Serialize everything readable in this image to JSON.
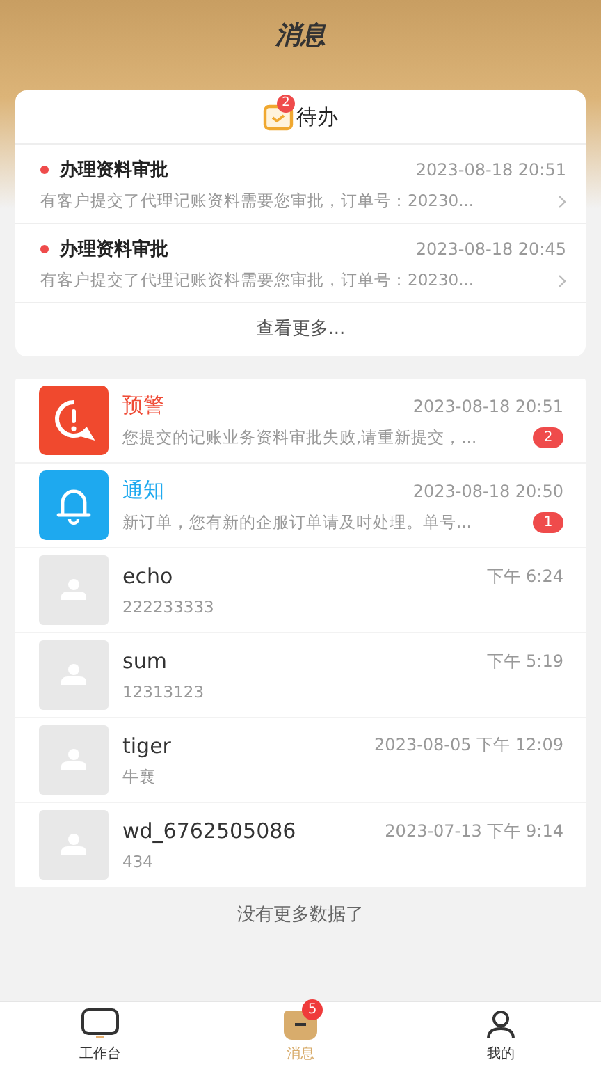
{
  "header": {
    "title": "消息"
  },
  "todo": {
    "title": "待办",
    "badge": "2",
    "items": [
      {
        "title": "办理资料审批",
        "time": "2023-08-18 20:51",
        "desc": "有客户提交了代理记账资料需要您审批，订单号：20230...",
        "unread": true
      },
      {
        "title": "办理资料审批",
        "time": "2023-08-18 20:45",
        "desc": "有客户提交了代理记账资料需要您审批，订单号：20230...",
        "unread": true
      }
    ],
    "more": "查看更多..."
  },
  "messages": [
    {
      "kind": "alert",
      "name": "预警",
      "time": "2023-08-18 20:51",
      "preview": "您提交的记账业务资料审批失败,请重新提交，...",
      "badge": "2"
    },
    {
      "kind": "notice",
      "name": "通知",
      "time": "2023-08-18 20:50",
      "preview": "新订单，您有新的企服订单请及时处理。单号...",
      "badge": "1"
    },
    {
      "kind": "contact",
      "name": "echo",
      "time": "下午 6:24",
      "preview": "222233333"
    },
    {
      "kind": "contact",
      "name": "sum",
      "time": "下午 5:19",
      "preview": "12313123"
    },
    {
      "kind": "contact",
      "name": "tiger",
      "time": "2023-08-05 下午 12:09",
      "preview": "牛襄"
    },
    {
      "kind": "contact",
      "name": "wd_6762505086",
      "time": "2023-07-13 下午 9:14",
      "preview": "434"
    }
  ],
  "footer_note": "没有更多数据了",
  "tabs": [
    {
      "label": "工作台",
      "selected": false
    },
    {
      "label": "消息",
      "selected": true,
      "badge": "5"
    },
    {
      "label": "我的",
      "selected": false
    }
  ]
}
